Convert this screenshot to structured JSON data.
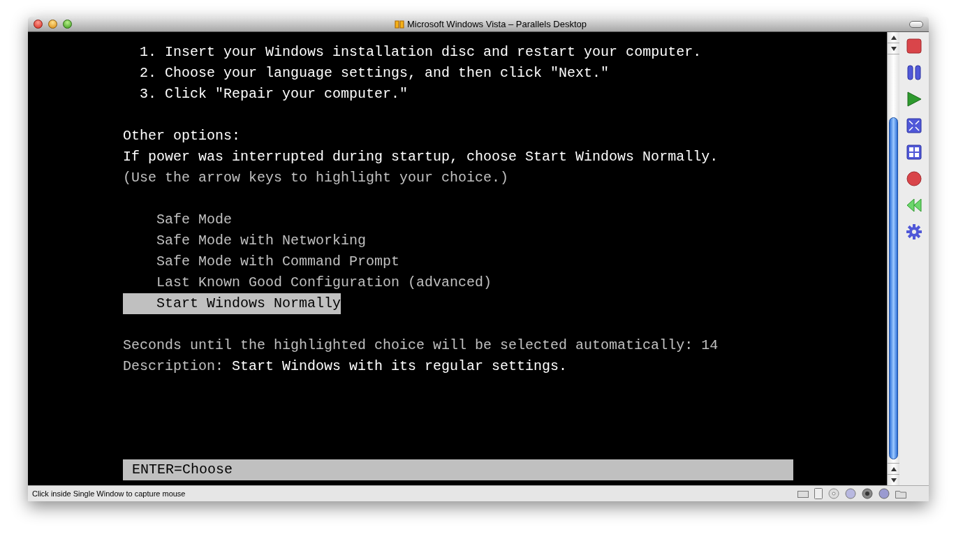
{
  "window": {
    "title": "Microsoft Windows Vista – Parallels Desktop"
  },
  "screen": {
    "steps": [
      {
        "number": "1.",
        "text": "Insert your Windows installation disc and restart your computer."
      },
      {
        "number": "2.",
        "text": "Choose your language settings, and then click \"Next.\""
      },
      {
        "number": "3.",
        "text": "Click \"Repair your computer.\""
      }
    ],
    "other_options_heading": "Other options:",
    "power_note": "If power was interrupted during startup, choose Start Windows Normally.",
    "hint": "(Use the arrow keys to highlight your choice.)",
    "boot_options": [
      {
        "label": "Safe Mode",
        "selected": false
      },
      {
        "label": "Safe Mode with Networking",
        "selected": false
      },
      {
        "label": "Safe Mode with Command Prompt",
        "selected": false
      },
      {
        "label": "Last Known Good Configuration (advanced)",
        "selected": false
      },
      {
        "label": "Start Windows Normally",
        "selected": true
      }
    ],
    "countdown": {
      "label": "Seconds until the highlighted choice will be selected automatically:",
      "value": "14"
    },
    "description": {
      "label": "Description:",
      "text": "Start Windows with its regular settings."
    },
    "footer": "ENTER=Choose"
  },
  "status_bar": {
    "text": "Click inside Single Window to capture mouse"
  }
}
